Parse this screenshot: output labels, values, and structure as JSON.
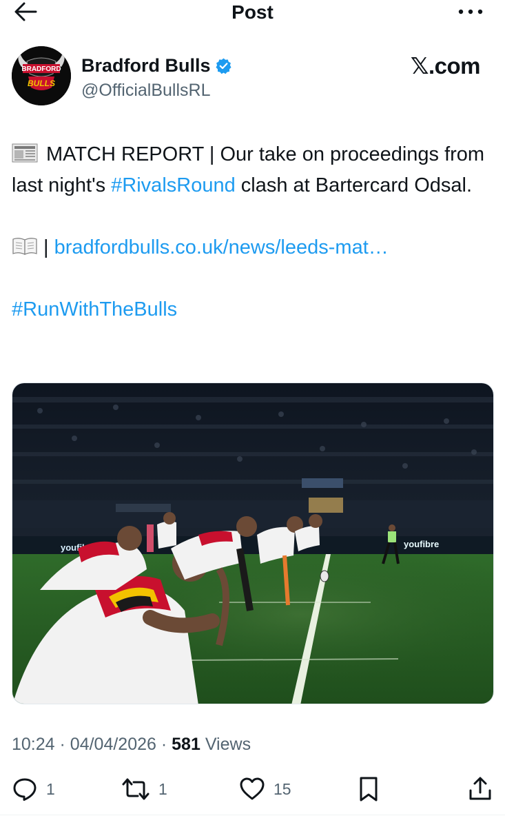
{
  "header": {
    "title": "Post"
  },
  "author": {
    "name": "Bradford Bulls",
    "handle": "@OfficialBullsRL",
    "verified": true,
    "avatar_text_top": "BRADFORD",
    "avatar_text_bottom": "BULLS"
  },
  "source_label": "𝕏.com",
  "tweet": {
    "line1_emoji": "newspaper-icon",
    "line1_text": "MATCH REPORT | Our take on proceedings from last night's ",
    "hashtag1": "#RivalsRound",
    "line1_tail": " clash at Bartercard Odsal.",
    "line2_emoji": "open-book-icon",
    "line2_sep": "| ",
    "link": "bradfordbulls.co.uk/news/leeds-mat…",
    "hashtag2": "#RunWithTheBulls"
  },
  "media": {
    "description_icon": "rugby-kickoff-photo",
    "board_text": "youfibre"
  },
  "meta": {
    "time": "10:24",
    "date": "04/04/2026",
    "views_count": "581",
    "views_label": "Views"
  },
  "actions": {
    "replies": "1",
    "reposts": "1",
    "likes": "15"
  },
  "colors": {
    "link": "#1d9bf0",
    "verified": "#1d9bf0",
    "muted": "#536471"
  }
}
